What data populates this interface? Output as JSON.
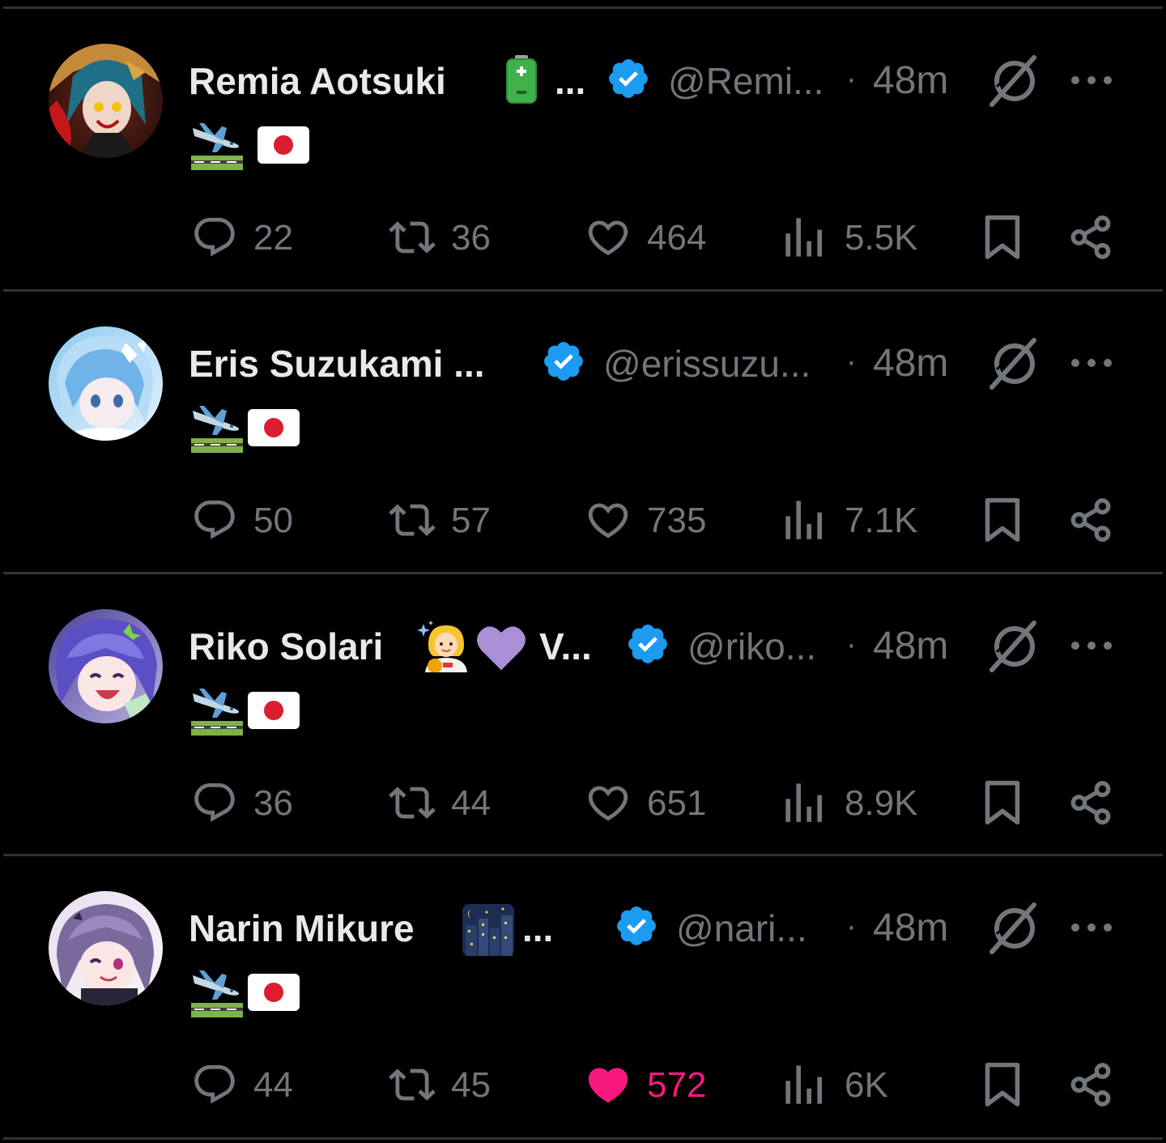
{
  "colors": {
    "background": "#000000",
    "divider": "#2f3336",
    "text_primary": "#e7e9ea",
    "text_secondary": "#71767b",
    "verified": "#1d9bf0",
    "like_active": "#f91880"
  },
  "tweets": [
    {
      "display_name": "Remia Aotsuki",
      "name_emoji": "battery",
      "name_ellipsis": "...",
      "verified_icon": "verified-badge-icon",
      "handle": "@Remi...",
      "separator": "·",
      "time": "48m",
      "body_emojis": [
        "airplane-arrival-emoji",
        "japan-flag-emoji"
      ],
      "replies": "22",
      "reposts": "36",
      "likes": "464",
      "liked": false,
      "views": "5.5K"
    },
    {
      "display_name": "Eris Suzukami ...",
      "name_emoji": "",
      "name_ellipsis": "",
      "verified_icon": "verified-badge-icon",
      "handle": "@erissuzu...",
      "separator": "·",
      "time": "48m",
      "body_emojis": [
        "airplane-arrival-emoji",
        "japan-flag-emoji"
      ],
      "replies": "50",
      "reposts": "57",
      "likes": "735",
      "liked": false,
      "views": "7.1K"
    },
    {
      "display_name": "Riko Solari",
      "name_emoji": "astronaut-and-purple-heart",
      "name_ellipsis": "V...",
      "verified_icon": "verified-badge-icon",
      "handle": "@riko...",
      "separator": "·",
      "time": "48m",
      "body_emojis": [
        "airplane-arrival-emoji",
        "japan-flag-emoji"
      ],
      "replies": "36",
      "reposts": "44",
      "likes": "651",
      "liked": false,
      "views": "8.9K"
    },
    {
      "display_name": "Narin Mikure",
      "name_emoji": "night-city",
      "name_ellipsis": "...",
      "verified_icon": "verified-badge-icon",
      "handle": "@nari...",
      "separator": "·",
      "time": "48m",
      "body_emojis": [
        "airplane-arrival-emoji",
        "japan-flag-emoji"
      ],
      "replies": "44",
      "reposts": "45",
      "likes": "572",
      "liked": true,
      "views": "6K"
    }
  ]
}
